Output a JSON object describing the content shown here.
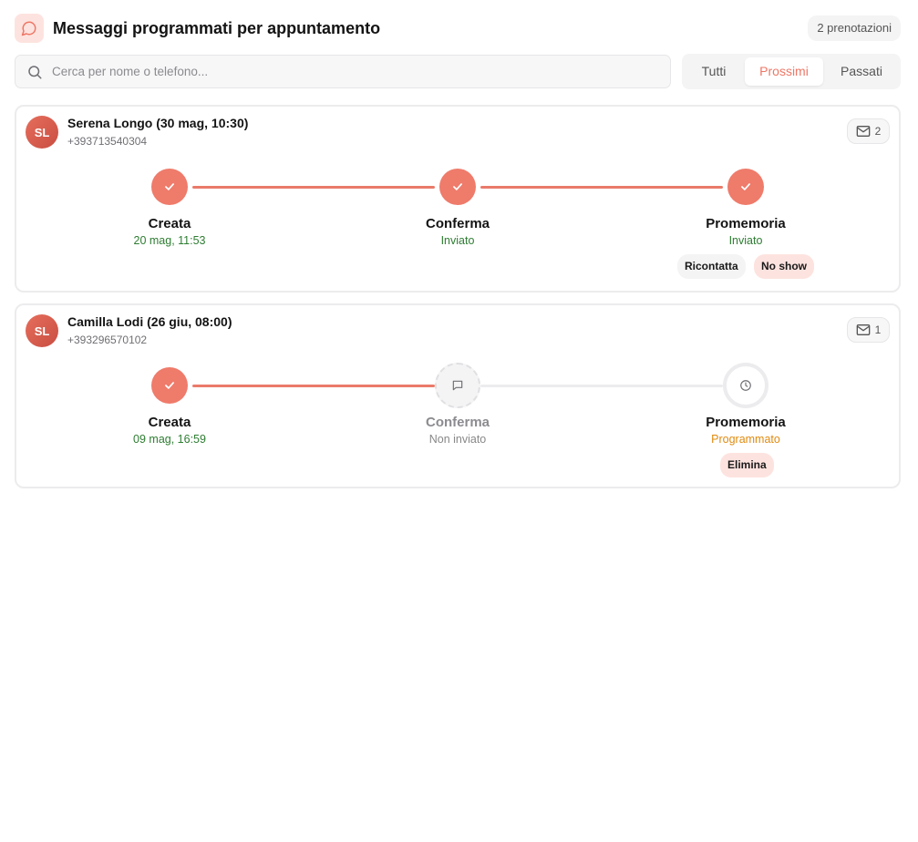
{
  "header": {
    "title": "Messaggi programmati per appuntamento",
    "icon": "chat-bubble-icon",
    "count_label": "2 prenotazioni"
  },
  "search": {
    "placeholder": "Cerca per nome o telefono...",
    "value": ""
  },
  "filter_tabs": [
    {
      "label": "Tutti",
      "active": false
    },
    {
      "label": "Prossimi",
      "active": true
    },
    {
      "label": "Passati",
      "active": false
    }
  ],
  "colors": {
    "accent": "#ef7b6b",
    "success_text": "#2e7d32",
    "scheduled_text": "#e08a10",
    "danger_chip_bg": "#fde3df"
  },
  "bookings": [
    {
      "initials": "SL",
      "name": "Serena Longo (30 mag, 10:30)",
      "phone": "+393713540304",
      "message_count": "2",
      "steps": [
        {
          "label": "Creata",
          "status": "20 mag, 11:53",
          "state": "done"
        },
        {
          "label": "Conferma",
          "status": "Inviato",
          "state": "done"
        },
        {
          "label": "Promemoria",
          "status": "Inviato",
          "state": "done"
        }
      ],
      "actions": [
        "Ricontatta",
        "No show"
      ]
    },
    {
      "initials": "SL",
      "name": "Camilla Lodi (26 giu, 08:00)",
      "phone": "+393296570102",
      "message_count": "1",
      "steps": [
        {
          "label": "Creata",
          "status": "09 mag, 16:59",
          "state": "done"
        },
        {
          "label": "Conferma",
          "status": "Non inviato",
          "state": "pending"
        },
        {
          "label": "Promemoria",
          "status": "Programmato",
          "state": "scheduled"
        }
      ],
      "actions": [
        "Elimina"
      ]
    }
  ]
}
